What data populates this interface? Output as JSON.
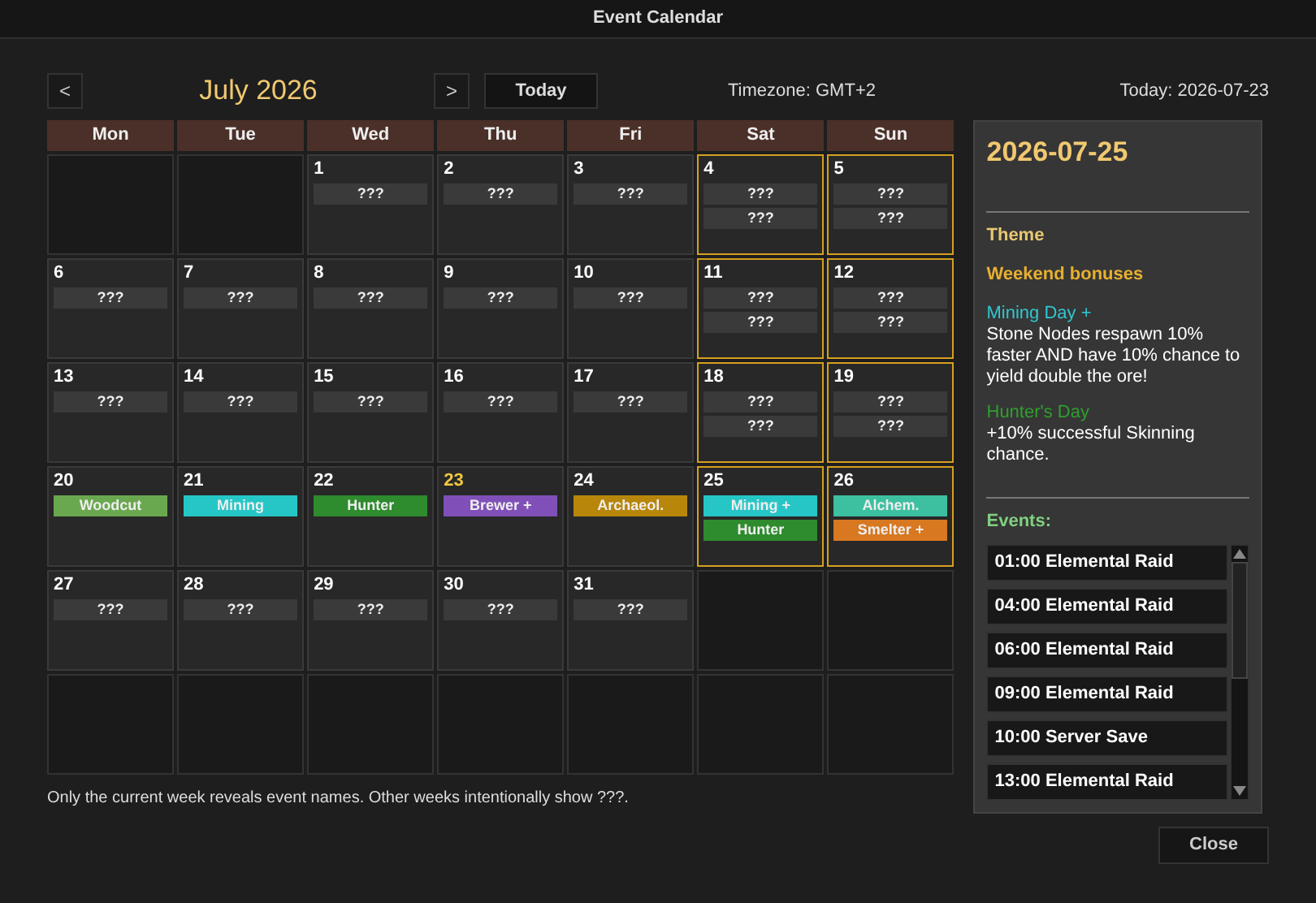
{
  "window": {
    "title": "Event Calendar"
  },
  "nav": {
    "prev": "<",
    "month": "July 2026",
    "next": ">",
    "today_button": "Today",
    "timezone": "Timezone: GMT+2",
    "today_date": "Today: 2026-07-23"
  },
  "weekdays": [
    "Mon",
    "Tue",
    "Wed",
    "Thu",
    "Fri",
    "Sat",
    "Sun"
  ],
  "weeks": [
    [
      {
        "kind": "empty"
      },
      {
        "kind": "empty"
      },
      {
        "kind": "day",
        "day": "1",
        "weekend": false,
        "today": false,
        "chips": [
          {
            "label": "???",
            "color": "#3a3a3a"
          }
        ]
      },
      {
        "kind": "day",
        "day": "2",
        "weekend": false,
        "today": false,
        "chips": [
          {
            "label": "???",
            "color": "#3a3a3a"
          }
        ]
      },
      {
        "kind": "day",
        "day": "3",
        "weekend": false,
        "today": false,
        "chips": [
          {
            "label": "???",
            "color": "#3a3a3a"
          }
        ]
      },
      {
        "kind": "day",
        "day": "4",
        "weekend": true,
        "today": false,
        "chips": [
          {
            "label": "???",
            "color": "#3a3a3a"
          },
          {
            "label": "???",
            "color": "#3a3a3a"
          }
        ]
      },
      {
        "kind": "day",
        "day": "5",
        "weekend": true,
        "today": false,
        "chips": [
          {
            "label": "???",
            "color": "#3a3a3a"
          },
          {
            "label": "???",
            "color": "#3a3a3a"
          }
        ]
      }
    ],
    [
      {
        "kind": "day",
        "day": "6",
        "weekend": false,
        "today": false,
        "chips": [
          {
            "label": "???",
            "color": "#3a3a3a"
          }
        ]
      },
      {
        "kind": "day",
        "day": "7",
        "weekend": false,
        "today": false,
        "chips": [
          {
            "label": "???",
            "color": "#3a3a3a"
          }
        ]
      },
      {
        "kind": "day",
        "day": "8",
        "weekend": false,
        "today": false,
        "chips": [
          {
            "label": "???",
            "color": "#3a3a3a"
          }
        ]
      },
      {
        "kind": "day",
        "day": "9",
        "weekend": false,
        "today": false,
        "chips": [
          {
            "label": "???",
            "color": "#3a3a3a"
          }
        ]
      },
      {
        "kind": "day",
        "day": "10",
        "weekend": false,
        "today": false,
        "chips": [
          {
            "label": "???",
            "color": "#3a3a3a"
          }
        ]
      },
      {
        "kind": "day",
        "day": "11",
        "weekend": true,
        "today": false,
        "chips": [
          {
            "label": "???",
            "color": "#3a3a3a"
          },
          {
            "label": "???",
            "color": "#3a3a3a"
          }
        ]
      },
      {
        "kind": "day",
        "day": "12",
        "weekend": true,
        "today": false,
        "chips": [
          {
            "label": "???",
            "color": "#3a3a3a"
          },
          {
            "label": "???",
            "color": "#3a3a3a"
          }
        ]
      }
    ],
    [
      {
        "kind": "day",
        "day": "13",
        "weekend": false,
        "today": false,
        "chips": [
          {
            "label": "???",
            "color": "#3a3a3a"
          }
        ]
      },
      {
        "kind": "day",
        "day": "14",
        "weekend": false,
        "today": false,
        "chips": [
          {
            "label": "???",
            "color": "#3a3a3a"
          }
        ]
      },
      {
        "kind": "day",
        "day": "15",
        "weekend": false,
        "today": false,
        "chips": [
          {
            "label": "???",
            "color": "#3a3a3a"
          }
        ]
      },
      {
        "kind": "day",
        "day": "16",
        "weekend": false,
        "today": false,
        "chips": [
          {
            "label": "???",
            "color": "#3a3a3a"
          }
        ]
      },
      {
        "kind": "day",
        "day": "17",
        "weekend": false,
        "today": false,
        "chips": [
          {
            "label": "???",
            "color": "#3a3a3a"
          }
        ]
      },
      {
        "kind": "day",
        "day": "18",
        "weekend": true,
        "today": false,
        "chips": [
          {
            "label": "???",
            "color": "#3a3a3a"
          },
          {
            "label": "???",
            "color": "#3a3a3a"
          }
        ]
      },
      {
        "kind": "day",
        "day": "19",
        "weekend": true,
        "today": false,
        "chips": [
          {
            "label": "???",
            "color": "#3a3a3a"
          },
          {
            "label": "???",
            "color": "#3a3a3a"
          }
        ]
      }
    ],
    [
      {
        "kind": "day",
        "day": "20",
        "weekend": false,
        "today": false,
        "chips": [
          {
            "label": "Woodcut",
            "color": "#6aa84f"
          }
        ]
      },
      {
        "kind": "day",
        "day": "21",
        "weekend": false,
        "today": false,
        "chips": [
          {
            "label": "Mining",
            "color": "#26c6c6"
          }
        ]
      },
      {
        "kind": "day",
        "day": "22",
        "weekend": false,
        "today": false,
        "chips": [
          {
            "label": "Hunter",
            "color": "#2e8b2e"
          }
        ]
      },
      {
        "kind": "day",
        "day": "23",
        "weekend": false,
        "today": true,
        "chips": [
          {
            "label": "Brewer +",
            "color": "#8050b8"
          }
        ]
      },
      {
        "kind": "day",
        "day": "24",
        "weekend": false,
        "today": false,
        "chips": [
          {
            "label": "Archaeol.",
            "color": "#b8860b"
          }
        ]
      },
      {
        "kind": "day",
        "day": "25",
        "weekend": true,
        "today": false,
        "chips": [
          {
            "label": "Mining +",
            "color": "#26c6c6"
          },
          {
            "label": "Hunter",
            "color": "#2e8b2e"
          }
        ]
      },
      {
        "kind": "day",
        "day": "26",
        "weekend": true,
        "today": false,
        "chips": [
          {
            "label": "Alchem.",
            "color": "#3cc0a0"
          },
          {
            "label": "Smelter +",
            "color": "#d87820"
          }
        ]
      }
    ],
    [
      {
        "kind": "day",
        "day": "27",
        "weekend": false,
        "today": false,
        "chips": [
          {
            "label": "???",
            "color": "#3a3a3a"
          }
        ]
      },
      {
        "kind": "day",
        "day": "28",
        "weekend": false,
        "today": false,
        "chips": [
          {
            "label": "???",
            "color": "#3a3a3a"
          }
        ]
      },
      {
        "kind": "day",
        "day": "29",
        "weekend": false,
        "today": false,
        "chips": [
          {
            "label": "???",
            "color": "#3a3a3a"
          }
        ]
      },
      {
        "kind": "day",
        "day": "30",
        "weekend": false,
        "today": false,
        "chips": [
          {
            "label": "???",
            "color": "#3a3a3a"
          }
        ]
      },
      {
        "kind": "day",
        "day": "31",
        "weekend": false,
        "today": false,
        "chips": [
          {
            "label": "???",
            "color": "#3a3a3a"
          }
        ]
      },
      {
        "kind": "empty"
      },
      {
        "kind": "empty"
      }
    ],
    [
      {
        "kind": "empty"
      },
      {
        "kind": "empty"
      },
      {
        "kind": "empty"
      },
      {
        "kind": "empty"
      },
      {
        "kind": "empty"
      },
      {
        "kind": "empty"
      },
      {
        "kind": "empty"
      }
    ]
  ],
  "footer_note": "Only the current week reveals event names. Other weeks intentionally show ???.",
  "detail": {
    "date": "2026-07-25",
    "theme_label": "Theme",
    "theme_value": "Weekend bonuses",
    "bonuses": [
      {
        "title": "Mining Day +",
        "color": "#30c8d0",
        "description": "Stone Nodes respawn 10% faster AND have 10% chance to yield double the ore!"
      },
      {
        "title": "Hunter's Day",
        "color": "#2ea02e",
        "description": "+10% successful Skinning  chance."
      }
    ],
    "events_label": "Events:",
    "events": [
      "01:00 Elemental Raid",
      "04:00 Elemental Raid",
      "06:00 Elemental Raid",
      "09:00 Elemental Raid",
      "10:00 Server Save",
      "13:00 Elemental Raid"
    ]
  },
  "close_button": "Close"
}
